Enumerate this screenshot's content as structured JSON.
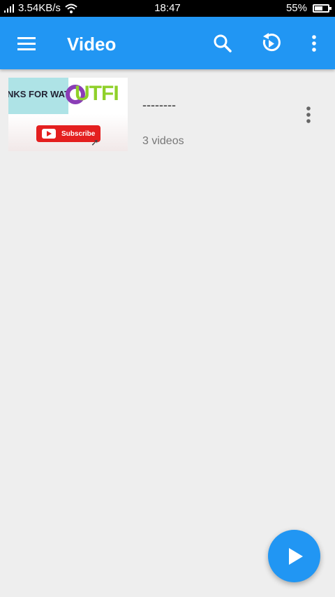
{
  "status_bar": {
    "network_speed": "3.54KB/s",
    "time": "18:47",
    "battery_percent": "55%",
    "battery_level": 0.55
  },
  "app_bar": {
    "title": "Video",
    "icons": [
      "menu-icon",
      "search-icon",
      "history-icon",
      "more-vert-icon"
    ],
    "color": "#2196f3"
  },
  "folder_list": [
    {
      "name": "--------",
      "count_label": "3 videos",
      "thumbnail_text": {
        "left": "NKS FOR WATCHI",
        "right": "UTFI",
        "button": "Subscribe"
      }
    }
  ],
  "fab": {
    "icon": "play-icon"
  }
}
